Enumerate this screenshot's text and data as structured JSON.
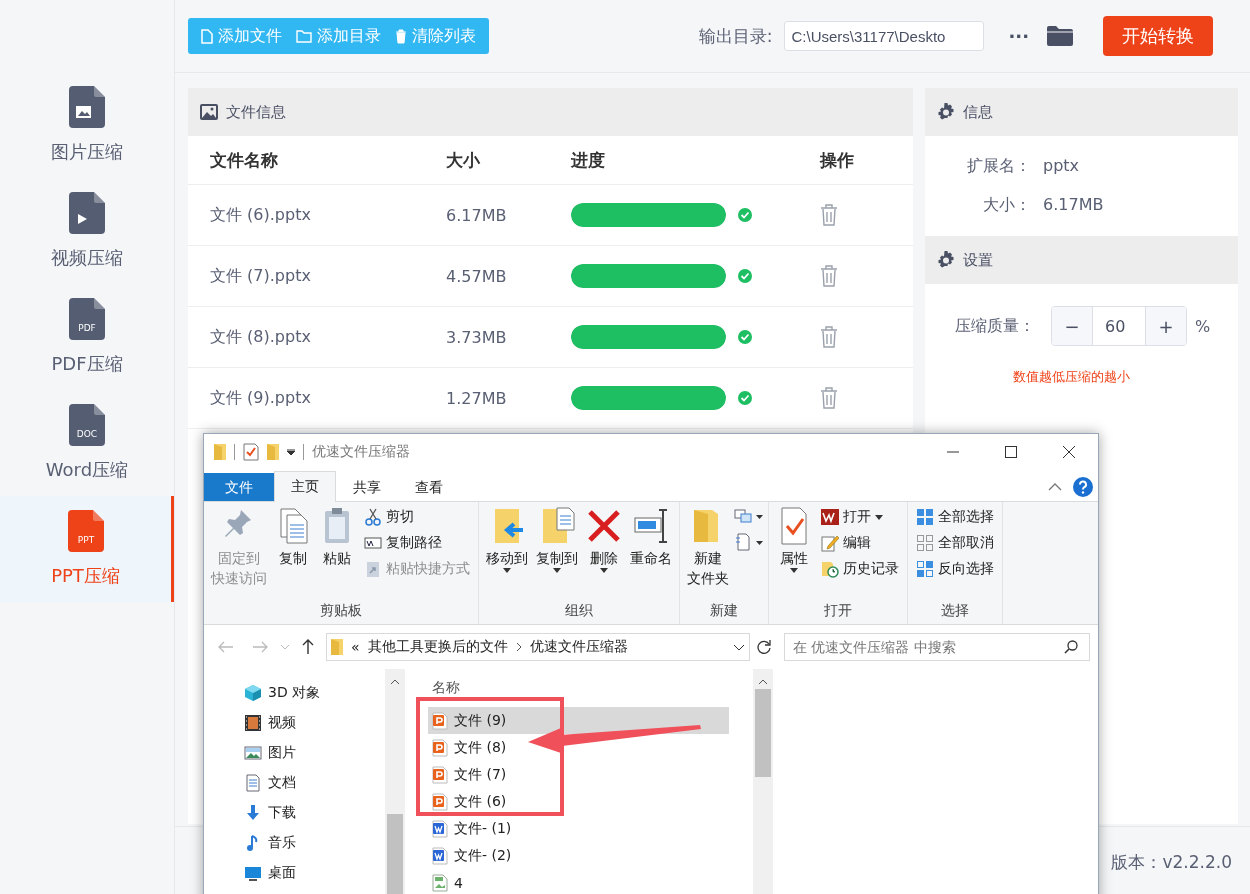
{
  "toolbar": {
    "buttons": [
      {
        "label": "添加文件",
        "kind": "file"
      },
      {
        "label": "添加目录",
        "kind": "folder"
      },
      {
        "label": "清除列表",
        "kind": "trash"
      }
    ],
    "output_label": "输出目录:",
    "output_path": "C:\\Users\\31177\\Deskto",
    "more": "···",
    "start_button": "开始转换"
  },
  "sidebar": {
    "items": [
      {
        "label": "图片压缩",
        "kind": "image",
        "selected": false
      },
      {
        "label": "视频压缩",
        "kind": "video",
        "selected": false
      },
      {
        "label": "PDF压缩",
        "kind": "badge",
        "badge": "PDF",
        "selected": false
      },
      {
        "label": "Word压缩",
        "kind": "badge",
        "badge": "DOC",
        "selected": false
      },
      {
        "label": "PPT压缩",
        "kind": "badge",
        "badge": "PPT",
        "selected": true
      }
    ]
  },
  "file_panel": {
    "title": "文件信息",
    "columns": [
      "文件名称",
      "大小",
      "进度",
      "操作"
    ],
    "rows": [
      {
        "name": "文件 (6).pptx",
        "size": "6.17MB",
        "level": 1,
        "done": true
      },
      {
        "name": "文件 (7).pptx",
        "size": "4.57MB",
        "level": 1,
        "done": true
      },
      {
        "name": "文件 (8).pptx",
        "size": "3.73MB",
        "level": 1,
        "done": true
      },
      {
        "name": "文件 (9).pptx",
        "size": "1.27MB",
        "level": 1,
        "done": true
      }
    ]
  },
  "info_panel": {
    "title": "信息",
    "fields": [
      {
        "label": "扩展名：",
        "value": "pptx"
      },
      {
        "label": "大小：",
        "value": "6.17MB"
      }
    ]
  },
  "settings_panel": {
    "title": "设置",
    "quality_label": "压缩质量：",
    "minus": "−",
    "value": "60",
    "plus": "+",
    "unit": "%",
    "hint": "数值越低压缩的越小"
  },
  "footer": {
    "version": "版本：v2.2.2.0"
  },
  "explorer": {
    "title": "优速文件压缩器",
    "tabs": [
      {
        "label": "文件",
        "kind": "file",
        "selected": false
      },
      {
        "label": "主页",
        "kind": "tab",
        "selected": true
      },
      {
        "label": "共享",
        "kind": "tab",
        "selected": false
      },
      {
        "label": "查看",
        "kind": "tab",
        "selected": false
      }
    ],
    "groups": [
      {
        "label": "剪贴板",
        "kind": "clipboard",
        "large": [
          {
            "lines": [
              "固定到",
              "快速访问"
            ],
            "kind": "pin",
            "disabled": true,
            "dropdown": false
          },
          {
            "lines": [
              "复制"
            ],
            "kind": "copy",
            "disabled": false,
            "dropdown": false
          },
          {
            "lines": [
              "粘贴"
            ],
            "kind": "paste",
            "disabled": false,
            "dropdown": false
          }
        ],
        "small": [
          {
            "label": "剪切",
            "kind": "cut",
            "disabled": false,
            "dropdown": false
          },
          {
            "label": "复制路径",
            "kind": "path",
            "disabled": false,
            "dropdown": false
          },
          {
            "label": "粘贴快捷方式",
            "kind": "shortcut",
            "disabled": true,
            "dropdown": false
          }
        ]
      },
      {
        "label": "组织",
        "kind": "organize",
        "large": [
          {
            "lines": [
              "移动到"
            ],
            "kind": "move",
            "disabled": false,
            "dropdown": true
          },
          {
            "lines": [
              "复制到"
            ],
            "kind": "copyto",
            "disabled": false,
            "dropdown": true
          },
          {
            "lines": [
              "删除"
            ],
            "kind": "delete",
            "disabled": false,
            "dropdown": true
          },
          {
            "lines": [
              "重命名"
            ],
            "kind": "rename",
            "disabled": false,
            "dropdown": false
          }
        ]
      },
      {
        "label": "新建",
        "kind": "new",
        "large": [
          {
            "lines": [
              "新建",
              "文件夹"
            ],
            "kind": "folder",
            "disabled": false,
            "dropdown": false
          }
        ]
      },
      {
        "label": "打开",
        "kind": "open",
        "large": [
          {
            "lines": [
              "属性"
            ],
            "kind": "props",
            "disabled": false,
            "dropdown": true
          }
        ],
        "small": [
          {
            "label": "打开",
            "kind": "open",
            "disabled": false,
            "dropdown": true
          },
          {
            "label": "编辑",
            "kind": "edit",
            "disabled": false,
            "dropdown": false
          },
          {
            "label": "历史记录",
            "kind": "history",
            "disabled": false,
            "dropdown": false
          }
        ]
      },
      {
        "label": "选择",
        "kind": "select",
        "small": [
          {
            "label": "全部选择",
            "kind": "selall",
            "disabled": false,
            "dropdown": false
          },
          {
            "label": "全部取消",
            "kind": "selnone",
            "disabled": false,
            "dropdown": false
          },
          {
            "label": "反向选择",
            "kind": "selinv",
            "disabled": false,
            "dropdown": false
          }
        ]
      }
    ],
    "address": {
      "prefix": "«",
      "crumbs": [
        "其他工具更换后的文件",
        "优速文件压缩器"
      ]
    },
    "search_placeholder": "在 优速文件压缩器 中搜索",
    "nav_items": [
      {
        "label": "3D 对象",
        "kind": "cube"
      },
      {
        "label": "视频",
        "kind": "film"
      },
      {
        "label": "图片",
        "kind": "picture"
      },
      {
        "label": "文档",
        "kind": "doc"
      },
      {
        "label": "下载",
        "kind": "download"
      },
      {
        "label": "音乐",
        "kind": "music"
      },
      {
        "label": "桌面",
        "kind": "desktop"
      }
    ],
    "list_header": "名称",
    "files": [
      {
        "name": "文件 (9)",
        "kind": "ppt",
        "selected": true
      },
      {
        "name": "文件 (8)",
        "kind": "ppt",
        "selected": false
      },
      {
        "name": "文件 (7)",
        "kind": "ppt",
        "selected": false
      },
      {
        "name": "文件 (6)",
        "kind": "ppt",
        "selected": false
      },
      {
        "name": "文件- (1)",
        "kind": "word",
        "selected": false
      },
      {
        "name": "文件- (2)",
        "kind": "word",
        "selected": false
      },
      {
        "name": "4",
        "kind": "image",
        "selected": false
      }
    ]
  }
}
